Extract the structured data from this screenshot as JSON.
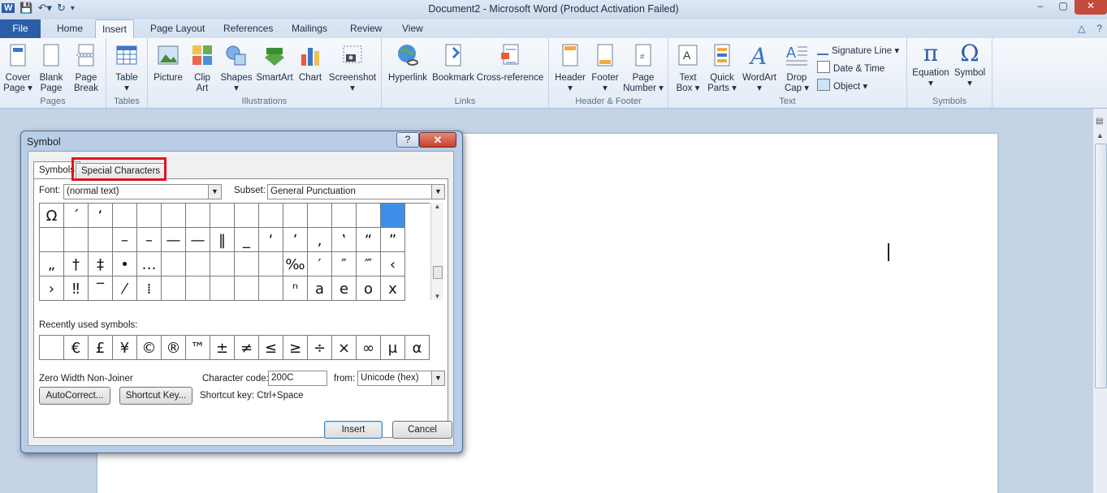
{
  "window": {
    "title": "Document2  -  Microsoft Word (Product Activation Failed)",
    "min": "–",
    "max": "▢",
    "close": "✕"
  },
  "ribbon_tabs": [
    "File",
    "Home",
    "Insert",
    "Page Layout",
    "References",
    "Mailings",
    "Review",
    "View"
  ],
  "active_tab": "Insert",
  "groups": {
    "pages": {
      "label": "Pages",
      "cover": "Cover",
      "cover2": "Page ▾",
      "blank": "Blank",
      "blank2": "Page",
      "break": "Page",
      "break2": "Break"
    },
    "tables": {
      "label": "Tables",
      "table": "Table",
      "table2": "▾"
    },
    "illustrations": {
      "label": "Illustrations",
      "picture": "Picture",
      "clipart": "Clip",
      "clipart2": "Art",
      "shapes": "Shapes",
      "shapes2": "▾",
      "smartart": "SmartArt",
      "chart": "Chart",
      "screenshot": "Screenshot",
      "screenshot2": "▾"
    },
    "links": {
      "label": "Links",
      "hyperlink": "Hyperlink",
      "bookmark": "Bookmark",
      "crossref": "Cross-reference"
    },
    "headerfooter": {
      "label": "Header & Footer",
      "header": "Header",
      "header2": "▾",
      "footer": "Footer",
      "footer2": "▾",
      "pagenum": "Page",
      "pagenum2": "Number ▾"
    },
    "text": {
      "label": "Text",
      "textbox": "Text",
      "textbox2": "Box ▾",
      "quickparts": "Quick",
      "quickparts2": "Parts ▾",
      "wordart": "WordArt",
      "wordart2": "▾",
      "dropcap": "Drop",
      "dropcap2": "Cap ▾",
      "sigline": "Signature Line ▾",
      "datetime": "Date & Time",
      "object": "Object ▾"
    },
    "symbols": {
      "label": "Symbols",
      "equation": "Equation",
      "equation2": "▾",
      "symbol": "Symbol",
      "symbol2": "▾"
    }
  },
  "dialog": {
    "title": "Symbol",
    "help": "?",
    "close": "✕",
    "tab_symbols": "Symbols",
    "tab_special": "Special Characters",
    "font_label": "Font:",
    "font_value": "(normal text)",
    "subset_label": "Subset:",
    "subset_value": "General Punctuation",
    "grid": [
      [
        "Ω",
        "´",
        "‘",
        "",
        "",
        "",
        "",
        "",
        "",
        "",
        "",
        "",
        "",
        "",
        ""
      ],
      [
        "",
        "",
        "",
        "–",
        "–",
        "—",
        "—",
        "‖",
        "_",
        "‘",
        "’",
        "‚",
        "‛",
        "“",
        "”"
      ],
      [
        "„",
        "†",
        "‡",
        "•",
        "…",
        "",
        "",
        "",
        "",
        "",
        "‰",
        "′",
        "″",
        "‴",
        "‹"
      ],
      [
        "›",
        "‼",
        "‾",
        "⁄",
        "⁞",
        "",
        "",
        "",
        "",
        "",
        "ⁿ",
        "a",
        "e",
        "o",
        "x"
      ]
    ],
    "recent_label": "Recently used symbols:",
    "recent": [
      "",
      "€",
      "£",
      "¥",
      "©",
      "®",
      "™",
      "±",
      "≠",
      "≤",
      "≥",
      "÷",
      "×",
      "∞",
      "μ",
      "α"
    ],
    "char_name": "Zero Width Non-Joiner",
    "charcode_label": "Character code:",
    "charcode_value": "200C",
    "from_label": "from:",
    "from_value": "Unicode (hex)",
    "autocorrect": "AutoCorrect...",
    "shortcutkey": "Shortcut Key...",
    "shortcut_text": "Shortcut key: Ctrl+Space",
    "insert": "Insert",
    "cancel": "Cancel"
  },
  "colors": {
    "accent": "#2c5ea8",
    "highlight": "#e0141c",
    "selection": "#3d8fe8"
  }
}
